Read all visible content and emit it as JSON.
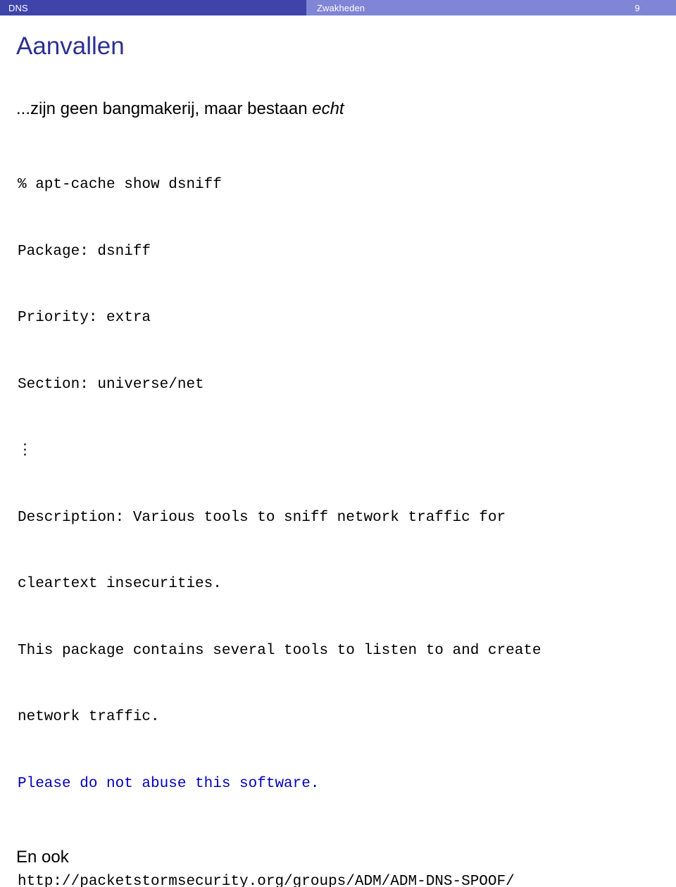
{
  "header": {
    "section_label": "DNS",
    "subsection_label": "Zwakheden",
    "page_number": "9",
    "left_color": "#3f44ab",
    "right_color": "#8085d6",
    "text_color": "#ffffff"
  },
  "slide": {
    "title": "Aanvallen",
    "title_color": "#2d3194",
    "lead": {
      "prefix": "...zijn geen bangmakerij, maar bestaan ",
      "emphasis": "echt"
    },
    "verbatim": {
      "lines": [
        "% apt-cache show dsniff",
        "Package: dsniff",
        "Priority: extra",
        "Section: universe/net"
      ],
      "ellipsis": "⋮",
      "lines2": [
        "Description: Various tools to sniff network traffic for",
        "cleartext insecurities."
      ],
      "lines3": [
        "This package contains several tools to listen to and create",
        "network traffic."
      ],
      "highlighted": "Please do not abuse this software.",
      "highlight_color": "#0000c0"
    },
    "tail": {
      "text": "En ook",
      "url": "http://packetstormsecurity.org/groups/ADM/ADM-DNS-SPOOF/"
    }
  }
}
